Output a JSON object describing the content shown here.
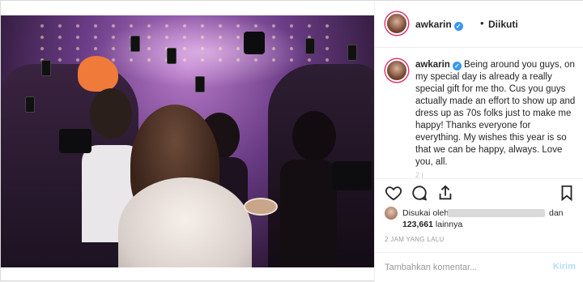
{
  "post": {
    "author": "awkarin",
    "follow_status": "Diikuti",
    "separator": "•",
    "caption_text": "Being around you guys, on my special day is already a really special gift for me tho. Cus you guys actually made an effort to show up and dress up as 70s folks just to make me happy! Thanks everyone for everything. My wishes this year is so that we can be happy, always. Love you, all.",
    "caption_time": "2 j"
  },
  "likes": {
    "liked_by_label": "Disukai oleh",
    "and_label": "dan",
    "count": "123,661",
    "count_suffix": "lainnya"
  },
  "time_ago": "2 JAM YANG LALU",
  "comment": {
    "placeholder": "Tambahkan komentar...",
    "submit_label": "Kirim"
  },
  "icons": {
    "verified": "verified-badge-icon",
    "like": "heart-icon",
    "comment": "comment-bubble-icon",
    "share": "share-icon",
    "save": "bookmark-icon"
  },
  "colors": {
    "verified_blue": "#3897f0",
    "post_button_disabled": "#b2dffc",
    "story_ring": "#e1306c"
  }
}
